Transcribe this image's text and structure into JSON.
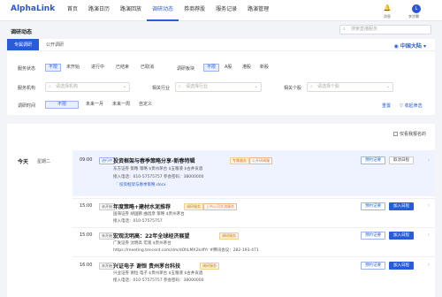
{
  "app": {
    "logo": "AlphaLink"
  },
  "nav": [
    "首页",
    "路演日历",
    "路演回放",
    "调研动态",
    "券商荐股",
    "服务记录",
    "路演管理"
  ],
  "header": {
    "notice": "消息",
    "user": "李涉腾",
    "avatar_char": "L"
  },
  "page": {
    "title": "调研动态",
    "search_placeholder": "搜索直播服务"
  },
  "tabs": [
    "专属调研",
    "公开调研"
  ],
  "region": "中国大陆",
  "filters": {
    "status_label": "服务状态",
    "status": [
      "不限",
      "未开始",
      "进行中",
      "已结束",
      "已取消"
    ],
    "block_label": "调研板块",
    "block": [
      "不限",
      "A股",
      "港股",
      "新股"
    ],
    "org_label": "服务机构",
    "org_ph": "请选择机构",
    "ind_label": "相关行业",
    "ind_ph": "请选择行业",
    "stock_label": "相关个股",
    "stock_ph": "请选择个股",
    "time_label": "调研时间",
    "time": [
      "不限",
      "未来一月",
      "未来一周",
      "自定义"
    ],
    "reset": "重置",
    "collapse": "收起筛选"
  },
  "list": {
    "only_mine": "仅看我报名的",
    "day": "今天",
    "weekday": "星期二",
    "events": [
      {
        "time": "09:00",
        "status": "进行中",
        "title": "投资框架与春季策略分享-新春特辑",
        "tags": [
          "专属服务",
          "公开研调服"
        ],
        "meta1": "东方证券    策略    策略    $贵州茅台    $五粮液    $古井贡酒",
        "meta2": "接入电话：010-57575757    参会密码：38000000",
        "doc": "投资框架与春季策略.docx",
        "btns": [
          "预约记要",
          "取消日程"
        ]
      },
      {
        "time": "15:00",
        "status": "未开始",
        "title": "年度策略+建材水泥推荐",
        "tags": [
          "调研服务",
          "上市公司交流服务"
        ],
        "meta1": "国海证券    胡国鹏  曲昌彦    策略    $贵州茅台",
        "meta2": "接入电话：010-57575757",
        "doc": "",
        "btns": [
          "预约记要",
          "加入日程"
        ]
      },
      {
        "time": "15:00",
        "status": "未开始",
        "title": "宏观沈明高：22年全球经济展望",
        "tags": [
          "调研服务"
        ],
        "meta1": "广发证券    沈明高    宏观    $贵州茅台",
        "meta2": "https://meeting.tencent.com/dm/dOhLMX2kdfYr  #腾讯会议：282-193-471",
        "doc": "",
        "btns": [
          "预约记要",
          "加入日程"
        ]
      },
      {
        "time": "16:00",
        "status": "未开始",
        "title": "兴证电子  谢恒  贵州茅台科技",
        "tags": [
          "调研服务"
        ],
        "meta1": "兴业证券    谢恒    电子    $贵州茅台    $五粮液    $古井贡酒",
        "meta2": "接入电话：010-57575757    参会密码：38000000",
        "doc": "",
        "btns": [
          "预约记要",
          "加入日程"
        ]
      }
    ]
  }
}
